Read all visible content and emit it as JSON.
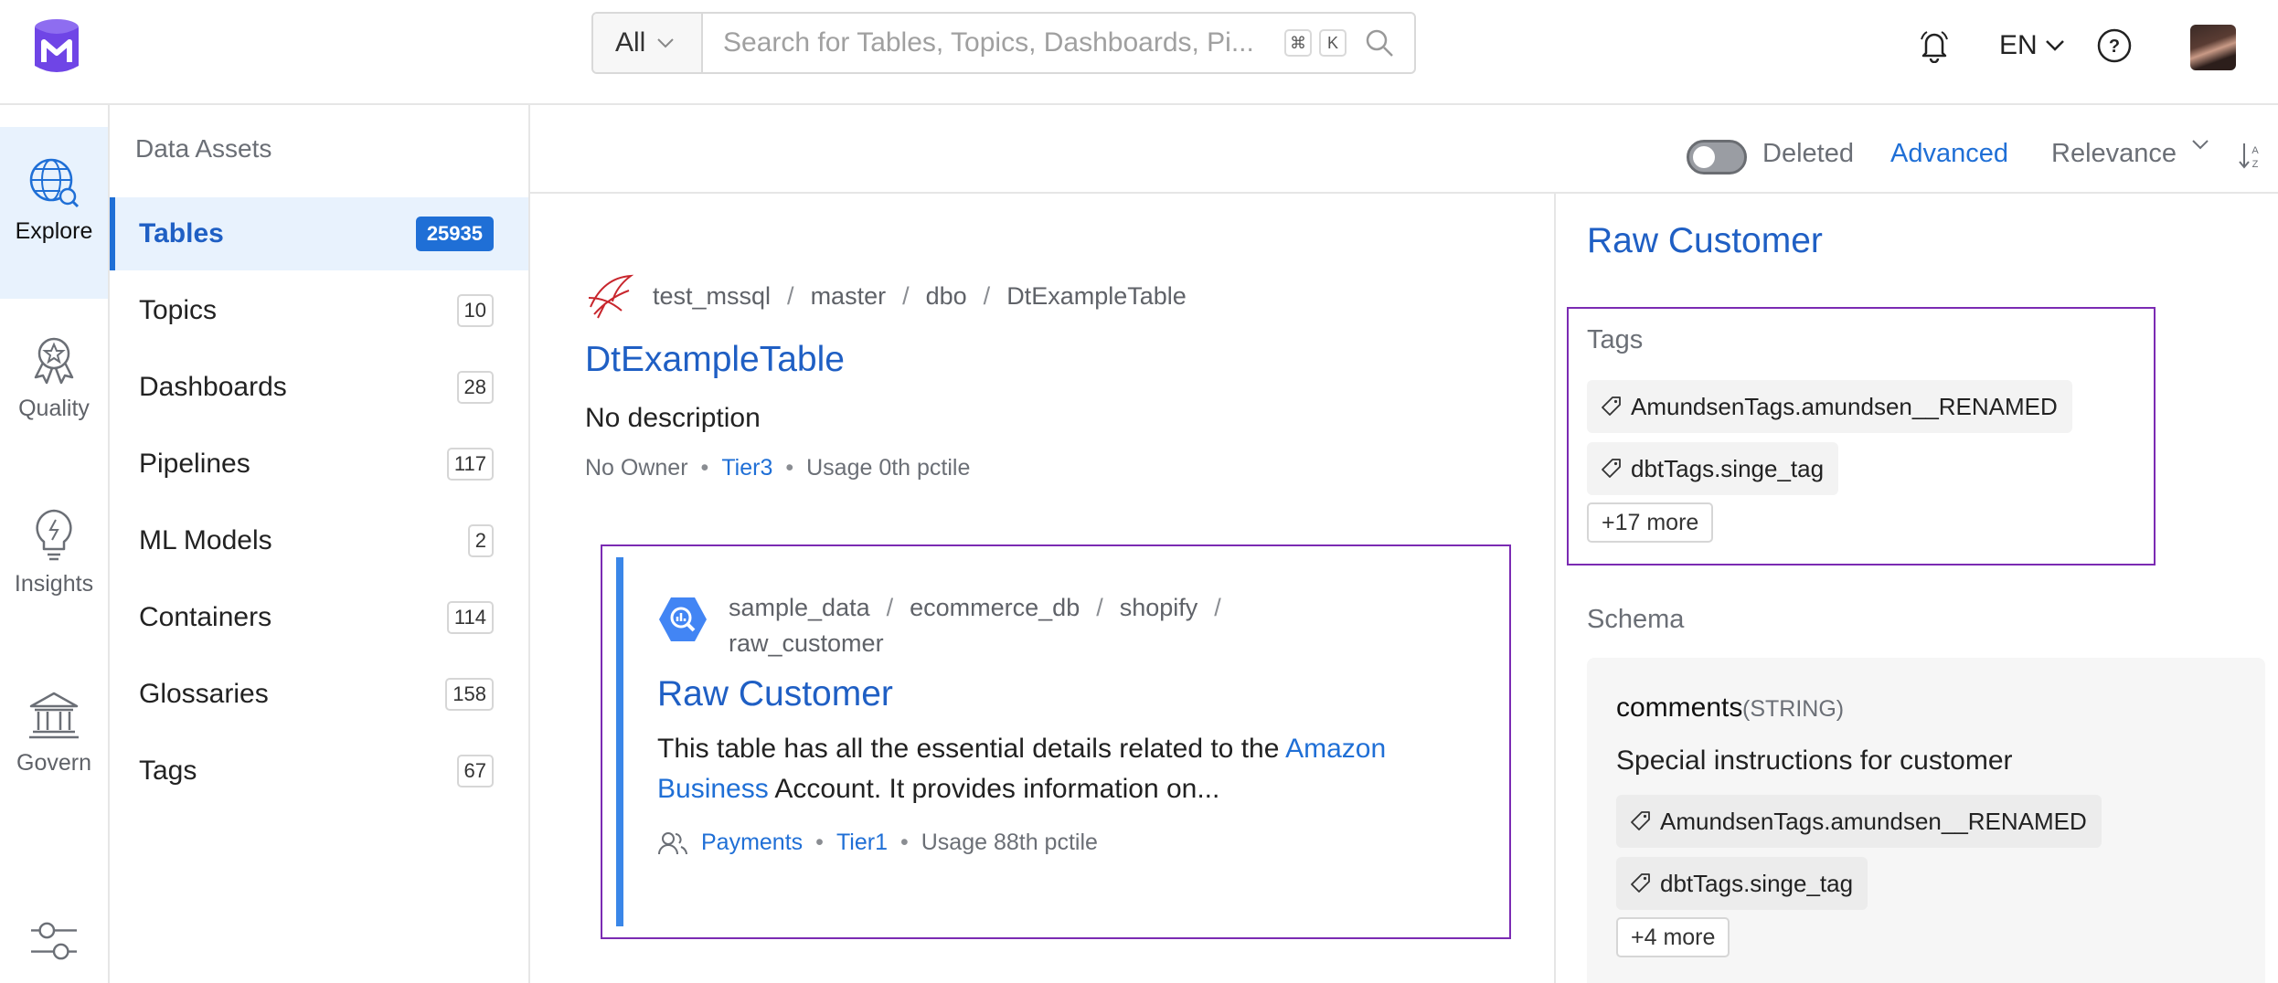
{
  "search": {
    "scope": "All",
    "placeholder": "Search for Tables, Topics, Dashboards, Pi...",
    "shortcut_cmd": "⌘",
    "shortcut_key": "K"
  },
  "header": {
    "language": "EN"
  },
  "left_nav": [
    {
      "label": "Explore",
      "icon": "explore-globe-icon"
    },
    {
      "label": "Quality",
      "icon": "quality-badge-icon"
    },
    {
      "label": "Insights",
      "icon": "insights-bulb-icon"
    },
    {
      "label": "Govern",
      "icon": "govern-bank-icon"
    }
  ],
  "facets": {
    "title": "Data Assets",
    "items": [
      {
        "label": "Tables",
        "count": "25935"
      },
      {
        "label": "Topics",
        "count": "10"
      },
      {
        "label": "Dashboards",
        "count": "28"
      },
      {
        "label": "Pipelines",
        "count": "117"
      },
      {
        "label": "ML Models",
        "count": "2"
      },
      {
        "label": "Containers",
        "count": "114"
      },
      {
        "label": "Glossaries",
        "count": "158"
      },
      {
        "label": "Tags",
        "count": "67"
      }
    ]
  },
  "toolbar": {
    "deleted_label": "Deleted",
    "advanced_label": "Advanced",
    "sort_label": "Relevance"
  },
  "results": [
    {
      "breadcrumb": [
        "test_mssql",
        "master",
        "dbo",
        "DtExampleTable"
      ],
      "title": "DtExampleTable",
      "description": "No description",
      "owner": "No Owner",
      "tier": "Tier3",
      "usage": "Usage 0th pctile"
    },
    {
      "breadcrumb": [
        "sample_data",
        "ecommerce_db",
        "shopify",
        "raw_customer"
      ],
      "title": "Raw Customer",
      "description_pre": "This table has all the essential details related to the",
      "description_link": "Amazon Business",
      "description_post": "Account. It provides information on...",
      "owner": "Payments",
      "tier": "Tier1",
      "usage": "Usage 88th pctile"
    }
  ],
  "summary": {
    "title": "Raw Customer",
    "tags_label": "Tags",
    "tags": [
      "AmundsenTags.amundsen__RENAMED",
      "dbtTags.singe_tag"
    ],
    "tags_more": "+17 more",
    "schema_label": "Schema",
    "column": {
      "name": "comments",
      "type": "(STRING)",
      "description": "Special instructions for customer",
      "tags": [
        "AmundsenTags.amundsen__RENAMED",
        "dbtTags.singe_tag"
      ],
      "tags_more": "+4 more"
    }
  },
  "colors": {
    "accent": "#1f6fd6",
    "brand": "#7147e8",
    "selection_outline": "#7b2bb3"
  }
}
